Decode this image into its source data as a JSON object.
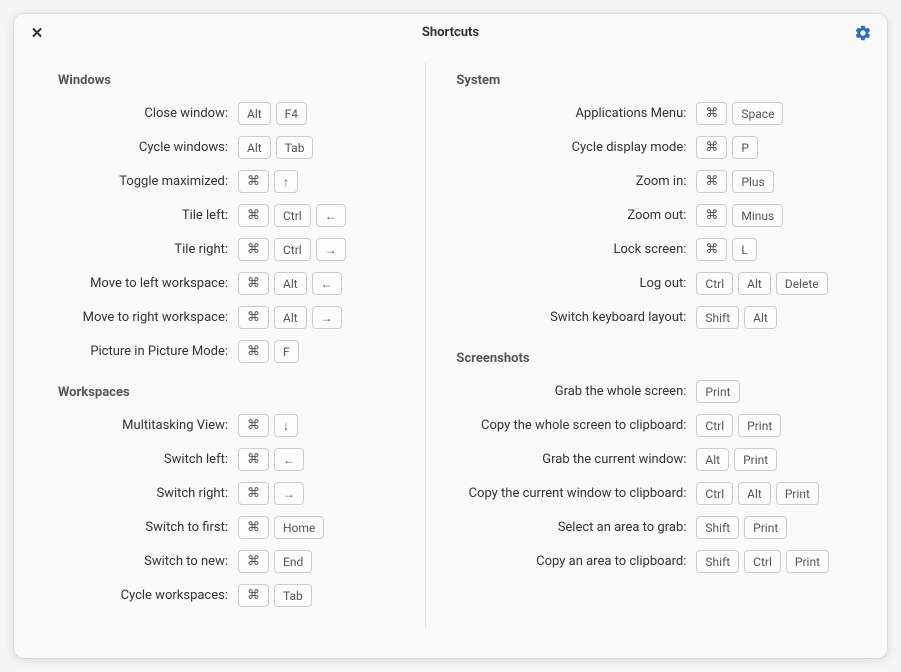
{
  "header": {
    "title": "Shortcuts"
  },
  "sections": {
    "windows": {
      "title": "Windows",
      "items": [
        {
          "label": "Close window:",
          "keys": [
            "Alt",
            "F4"
          ]
        },
        {
          "label": "Cycle windows:",
          "keys": [
            "Alt",
            "Tab"
          ]
        },
        {
          "label": "Toggle maximized:",
          "keys": [
            "cmd",
            "arrow-up"
          ]
        },
        {
          "label": "Tile left:",
          "keys": [
            "cmd",
            "Ctrl",
            "arrow-left"
          ]
        },
        {
          "label": "Tile right:",
          "keys": [
            "cmd",
            "Ctrl",
            "arrow-right"
          ]
        },
        {
          "label": "Move to left workspace:",
          "keys": [
            "cmd",
            "Alt",
            "arrow-left"
          ]
        },
        {
          "label": "Move to right workspace:",
          "keys": [
            "cmd",
            "Alt",
            "arrow-right"
          ]
        },
        {
          "label": "Picture in Picture Mode:",
          "keys": [
            "cmd",
            "F"
          ]
        }
      ]
    },
    "workspaces": {
      "title": "Workspaces",
      "items": [
        {
          "label": "Multitasking View:",
          "keys": [
            "cmd",
            "arrow-down"
          ]
        },
        {
          "label": "Switch left:",
          "keys": [
            "cmd",
            "arrow-left"
          ]
        },
        {
          "label": "Switch right:",
          "keys": [
            "cmd",
            "arrow-right"
          ]
        },
        {
          "label": "Switch to first:",
          "keys": [
            "cmd",
            "Home"
          ]
        },
        {
          "label": "Switch to new:",
          "keys": [
            "cmd",
            "End"
          ]
        },
        {
          "label": "Cycle workspaces:",
          "keys": [
            "cmd",
            "Tab"
          ]
        }
      ]
    },
    "system": {
      "title": "System",
      "items": [
        {
          "label": "Applications Menu:",
          "keys": [
            "cmd",
            "Space"
          ]
        },
        {
          "label": "Cycle display mode:",
          "keys": [
            "cmd",
            "P"
          ]
        },
        {
          "label": "Zoom in:",
          "keys": [
            "cmd",
            "Plus"
          ]
        },
        {
          "label": "Zoom out:",
          "keys": [
            "cmd",
            "Minus"
          ]
        },
        {
          "label": "Lock screen:",
          "keys": [
            "cmd",
            "L"
          ]
        },
        {
          "label": "Log out:",
          "keys": [
            "Ctrl",
            "Alt",
            "Delete"
          ]
        },
        {
          "label": "Switch keyboard layout:",
          "keys": [
            "Shift",
            "Alt"
          ]
        }
      ]
    },
    "screenshots": {
      "title": "Screenshots",
      "items": [
        {
          "label": "Grab the whole screen:",
          "keys": [
            "Print"
          ]
        },
        {
          "label": "Copy the whole screen to clipboard:",
          "keys": [
            "Ctrl",
            "Print"
          ]
        },
        {
          "label": "Grab the current window:",
          "keys": [
            "Alt",
            "Print"
          ]
        },
        {
          "label": "Copy the current window to clipboard:",
          "keys": [
            "Ctrl",
            "Alt",
            "Print"
          ]
        },
        {
          "label": "Select an area to grab:",
          "keys": [
            "Shift",
            "Print"
          ]
        },
        {
          "label": "Copy an area to clipboard:",
          "keys": [
            "Shift",
            "Ctrl",
            "Print"
          ]
        }
      ]
    }
  }
}
